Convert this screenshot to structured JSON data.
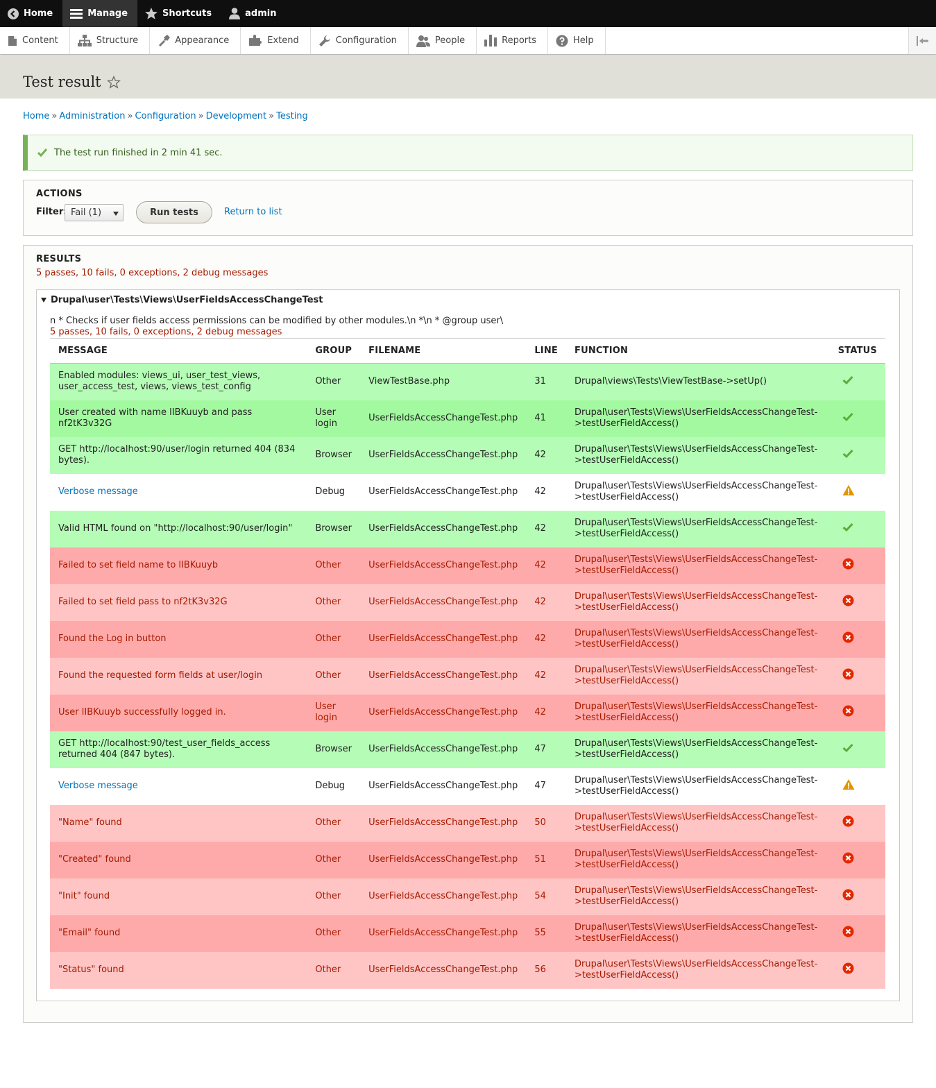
{
  "toolbar": {
    "items": [
      {
        "label": "Home",
        "icon": "back-arrow-icon"
      },
      {
        "label": "Manage",
        "icon": "menu-icon"
      },
      {
        "label": "Shortcuts",
        "icon": "star-icon"
      },
      {
        "label": "admin",
        "icon": "user-icon"
      }
    ]
  },
  "tray": {
    "items": [
      {
        "label": "Content",
        "icon": "file-icon"
      },
      {
        "label": "Structure",
        "icon": "structure-icon"
      },
      {
        "label": "Appearance",
        "icon": "paint-icon"
      },
      {
        "label": "Extend",
        "icon": "puzzle-icon"
      },
      {
        "label": "Configuration",
        "icon": "wrench-icon"
      },
      {
        "label": "People",
        "icon": "people-icon"
      },
      {
        "label": "Reports",
        "icon": "bar-chart-icon"
      },
      {
        "label": "Help",
        "icon": "help-icon"
      }
    ]
  },
  "page": {
    "title": "Test result"
  },
  "breadcrumb": [
    "Home",
    "Administration",
    "Configuration",
    "Development",
    "Testing"
  ],
  "status_message": "The test run finished in 2 min 41 sec.",
  "actions": {
    "legend": "ACTIONS",
    "filter_label": "Filter:",
    "filter_value": "Fail (1)",
    "run_button": "Run tests",
    "return_link": "Return to list"
  },
  "results": {
    "legend": "RESULTS",
    "summary": "5 passes, 10 fails, 0 exceptions, 2 debug messages",
    "group_title": "Drupal\\user\\Tests\\Views\\UserFieldsAccessChangeTest",
    "group_desc": "n * Checks if user fields access permissions can be modified by other modules.\\n *\\n * @group user\\",
    "group_summary": "5 passes, 10 fails, 0 exceptions, 2 debug messages",
    "columns": [
      "MESSAGE",
      "GROUP",
      "FILENAME",
      "LINE",
      "FUNCTION",
      "STATUS"
    ],
    "rows": [
      {
        "message": "Enabled modules: views_ui, user_test_views, user_access_test, views, views_test_config",
        "group": "Other",
        "file": "ViewTestBase.php",
        "line": "31",
        "function": "Drupal\\views\\Tests\\ViewTestBase->setUp()",
        "status": "pass"
      },
      {
        "message": "User created with name lIBKuuyb and pass nf2tK3v32G",
        "group": "User login",
        "file": "UserFieldsAccessChangeTest.php",
        "line": "41",
        "function": "Drupal\\user\\Tests\\Views\\UserFieldsAccessChangeTest->testUserFieldAccess()",
        "status": "pass"
      },
      {
        "message": "GET http://localhost:90/user/login returned 404 (834 bytes).",
        "group": "Browser",
        "file": "UserFieldsAccessChangeTest.php",
        "line": "42",
        "function": "Drupal\\user\\Tests\\Views\\UserFieldsAccessChangeTest->testUserFieldAccess()",
        "status": "pass"
      },
      {
        "message": "Verbose message",
        "group": "Debug",
        "file": "UserFieldsAccessChangeTest.php",
        "line": "42",
        "function": "Drupal\\user\\Tests\\Views\\UserFieldsAccessChangeTest->testUserFieldAccess()",
        "status": "debug"
      },
      {
        "message": "Valid HTML found on \"http://localhost:90/user/login\"",
        "group": "Browser",
        "file": "UserFieldsAccessChangeTest.php",
        "line": "42",
        "function": "Drupal\\user\\Tests\\Views\\UserFieldsAccessChangeTest->testUserFieldAccess()",
        "status": "pass"
      },
      {
        "message": "Failed to set field name to lIBKuuyb",
        "group": "Other",
        "file": "UserFieldsAccessChangeTest.php",
        "line": "42",
        "function": "Drupal\\user\\Tests\\Views\\UserFieldsAccessChangeTest->testUserFieldAccess()",
        "status": "fail"
      },
      {
        "message": "Failed to set field pass to nf2tK3v32G",
        "group": "Other",
        "file": "UserFieldsAccessChangeTest.php",
        "line": "42",
        "function": "Drupal\\user\\Tests\\Views\\UserFieldsAccessChangeTest->testUserFieldAccess()",
        "status": "fail"
      },
      {
        "message": "Found the Log in button",
        "group": "Other",
        "file": "UserFieldsAccessChangeTest.php",
        "line": "42",
        "function": "Drupal\\user\\Tests\\Views\\UserFieldsAccessChangeTest->testUserFieldAccess()",
        "status": "fail"
      },
      {
        "message": "Found the requested form fields at user/login",
        "group": "Other",
        "file": "UserFieldsAccessChangeTest.php",
        "line": "42",
        "function": "Drupal\\user\\Tests\\Views\\UserFieldsAccessChangeTest->testUserFieldAccess()",
        "status": "fail"
      },
      {
        "message": "User lIBKuuyb successfully logged in.",
        "group": "User login",
        "file": "UserFieldsAccessChangeTest.php",
        "line": "42",
        "function": "Drupal\\user\\Tests\\Views\\UserFieldsAccessChangeTest->testUserFieldAccess()",
        "status": "fail"
      },
      {
        "message": "GET http://localhost:90/test_user_fields_access returned 404 (847 bytes).",
        "group": "Browser",
        "file": "UserFieldsAccessChangeTest.php",
        "line": "47",
        "function": "Drupal\\user\\Tests\\Views\\UserFieldsAccessChangeTest->testUserFieldAccess()",
        "status": "pass"
      },
      {
        "message": "Verbose message",
        "group": "Debug",
        "file": "UserFieldsAccessChangeTest.php",
        "line": "47",
        "function": "Drupal\\user\\Tests\\Views\\UserFieldsAccessChangeTest->testUserFieldAccess()",
        "status": "debug"
      },
      {
        "message": "\"Name\" found",
        "group": "Other",
        "file": "UserFieldsAccessChangeTest.php",
        "line": "50",
        "function": "Drupal\\user\\Tests\\Views\\UserFieldsAccessChangeTest->testUserFieldAccess()",
        "status": "fail"
      },
      {
        "message": "\"Created\" found",
        "group": "Other",
        "file": "UserFieldsAccessChangeTest.php",
        "line": "51",
        "function": "Drupal\\user\\Tests\\Views\\UserFieldsAccessChangeTest->testUserFieldAccess()",
        "status": "fail"
      },
      {
        "message": "\"Init\" found",
        "group": "Other",
        "file": "UserFieldsAccessChangeTest.php",
        "line": "54",
        "function": "Drupal\\user\\Tests\\Views\\UserFieldsAccessChangeTest->testUserFieldAccess()",
        "status": "fail"
      },
      {
        "message": "\"Email\" found",
        "group": "Other",
        "file": "UserFieldsAccessChangeTest.php",
        "line": "55",
        "function": "Drupal\\user\\Tests\\Views\\UserFieldsAccessChangeTest->testUserFieldAccess()",
        "status": "fail"
      },
      {
        "message": "\"Status\" found",
        "group": "Other",
        "file": "UserFieldsAccessChangeTest.php",
        "line": "56",
        "function": "Drupal\\user\\Tests\\Views\\UserFieldsAccessChangeTest->testUserFieldAccess()",
        "status": "fail"
      }
    ]
  },
  "colors": {
    "pass": "#b5fdb6",
    "fail": "#ffc5c5",
    "fail_dark": "#ffaaaa",
    "link": "#0074bd",
    "fail_text": "#a51b00"
  }
}
